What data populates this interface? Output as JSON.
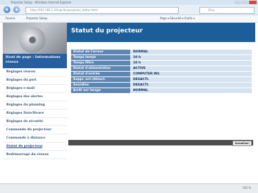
{
  "browser": {
    "title": "Projector Setup - Windows Internet Explorer",
    "address": "http://192.168.1.10/cgi-bin/projector_status.html",
    "search_placeholder": "Bing",
    "favorites_label": "Favoris",
    "tab_label": "Projector Setup",
    "tools_label": "Page ▾  Sécurité ▾  Outils ▾",
    "zoom": "100 %"
  },
  "header": {
    "title": "Statut du projecteur"
  },
  "sidebar": {
    "top_label": "Haut de page : Informations réseau",
    "items": [
      {
        "label": "Réglages réseau"
      },
      {
        "label": "Réglages du port"
      },
      {
        "label": "Réglages e-mail"
      },
      {
        "label": "Réglages des alertes"
      },
      {
        "label": "Réglages du planning"
      },
      {
        "label": "Réglages Date/Heure"
      },
      {
        "label": "Réglages de sécurité"
      },
      {
        "label": "Commande du projecteur"
      },
      {
        "label": "Commande à distance"
      },
      {
        "label": "Statut du projecteur"
      },
      {
        "label": "Redémarrage du réseau"
      }
    ]
  },
  "status_table": {
    "rows": [
      {
        "key": "Statut de l'erreur",
        "value": "NORMAL"
      },
      {
        "key": "Temps lampe",
        "value": "10 h"
      },
      {
        "key": "Temps filtre",
        "value": "10 h"
      },
      {
        "key": "Statut d'alimentation",
        "value": "ACTIVE"
      },
      {
        "key": "Statut d'entrée",
        "value": "COMPUTER IN1"
      },
      {
        "key": "Suppr. act./désact.",
        "value": "DESACTI."
      },
      {
        "key": "Sourdine",
        "value": "DESACTI."
      },
      {
        "key": "Arrêt sur image",
        "value": "NORMAL"
      }
    ]
  },
  "refresh_button": {
    "label": "Actualiser"
  }
}
